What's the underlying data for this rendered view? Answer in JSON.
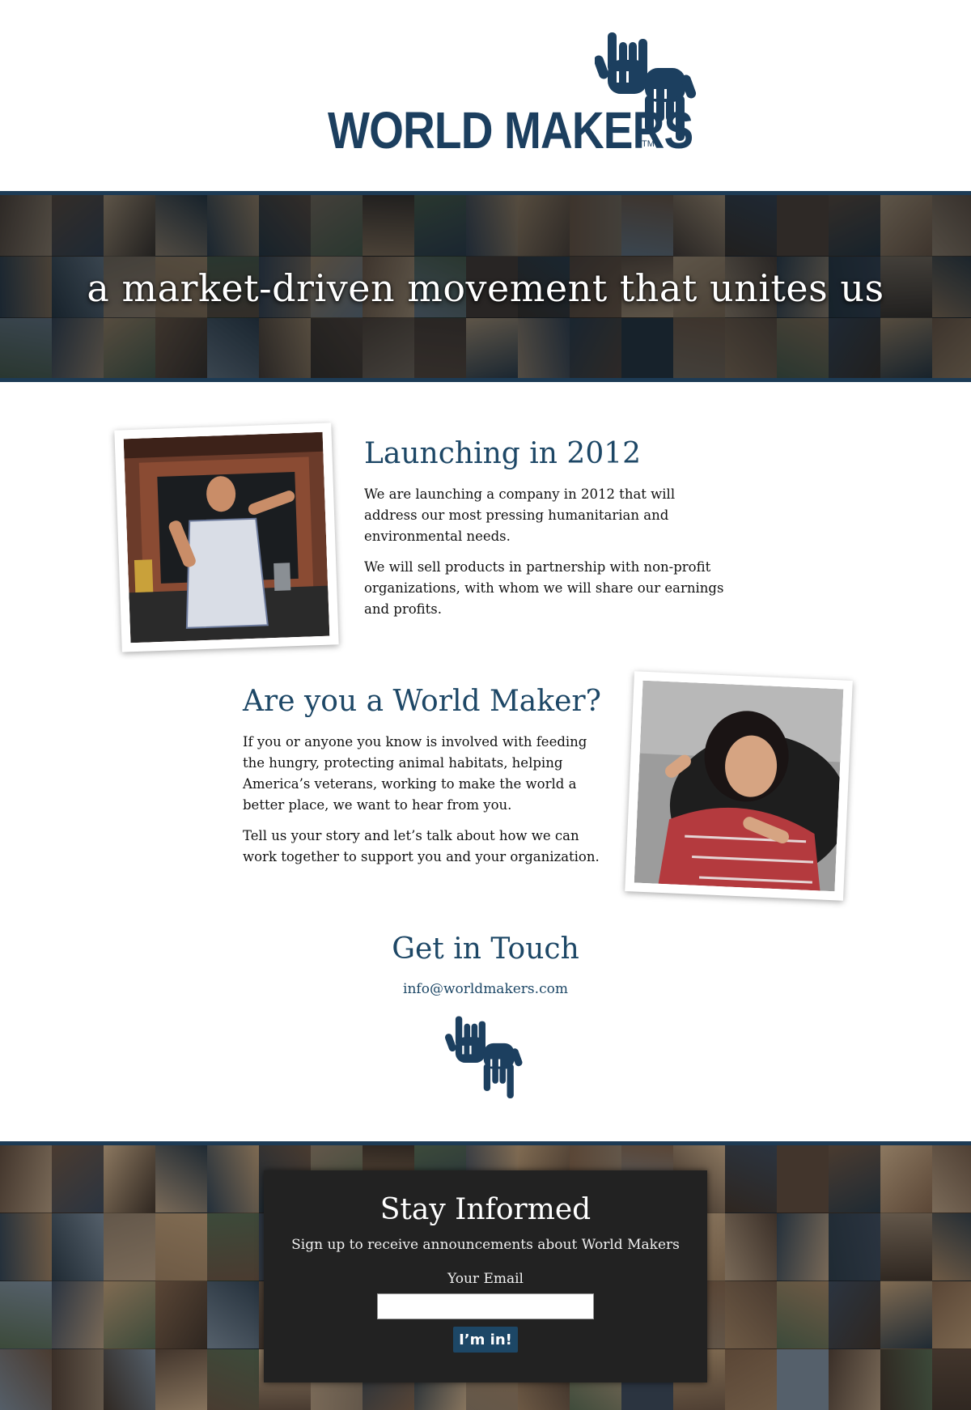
{
  "brand": {
    "name": "WORLD MAKERS",
    "trademark": "TM",
    "color": "#1c3f5f"
  },
  "hero": {
    "tagline": "a market-driven movement that unites us"
  },
  "sections": [
    {
      "title": "Launching in 2012",
      "paragraphs": [
        "We are launching a company in 2012 that will address our most pressing humanitarian and environmental needs.",
        "We will sell products in partnership with non-profit organizations, with whom we will share our earnings and profits."
      ]
    },
    {
      "title": "Are you a World Maker?",
      "paragraphs": [
        "If you or anyone you know is involved with feeding the hungry, protecting animal habitats, helping America’s veterans, working to make the world a better place, we want to hear from you.",
        "Tell us your story and let’s talk about how we can work together to support you and your organization."
      ]
    }
  ],
  "contact": {
    "title": "Get in Touch",
    "email": "info@worldmakers.com"
  },
  "signup": {
    "title": "Stay Informed",
    "subtitle": "Sign up to receive announcements about World Makers",
    "email_label": "Your Email",
    "email_value": "",
    "button_label": "I’m in!"
  },
  "colors": {
    "accent": "#1d4766",
    "band": "#1d3b55",
    "panel": "#222222"
  },
  "icons": {
    "logo_mark": "hand-gesture-w-m-icon",
    "footer_mark": "hand-gesture-w-m-icon"
  }
}
